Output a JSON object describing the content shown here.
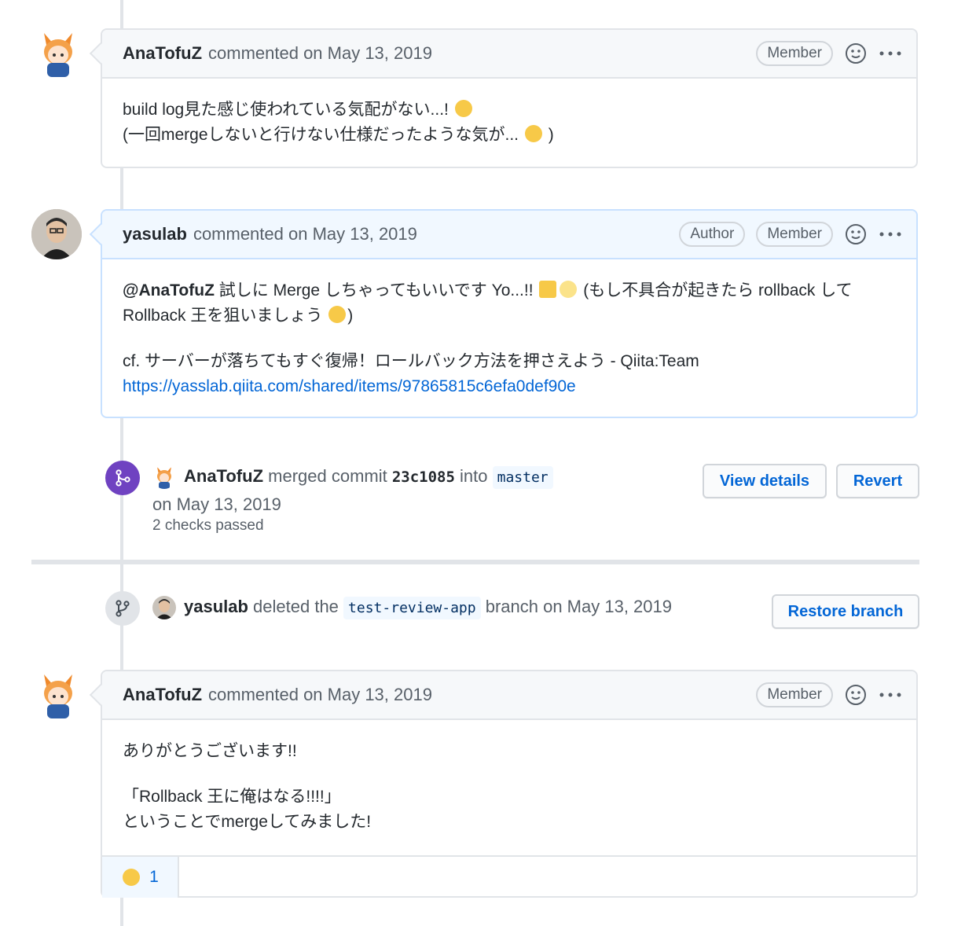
{
  "comments": [
    {
      "author": "AnaTofuZ",
      "meta": "commented on May 13, 2019",
      "badges": [
        "Member"
      ],
      "lines": [
        "build log見た感じ使われている気配がない...! ",
        "(一回mergeしないと行けない仕様だったような気が... ",
        " )"
      ]
    },
    {
      "author": "yasulab",
      "meta": "commented on May 13, 2019",
      "badges": [
        "Author",
        "Member"
      ],
      "mention": "@AnaTofuZ",
      "text1": " 試しに Merge しちゃってもいいです Yo...!! ",
      "text2": " (もし不具合が起きたら rollback して",
      "text3": "Rollback 王を狙いましょう ",
      "text4": ")",
      "cf_text": "cf. サーバーが落ちてもすぐ復帰！ロールバック方法を押さえよう - Qiita:Team",
      "link": "https://yasslab.qiita.com/shared/items/97865815c6efa0def90e"
    },
    {
      "author": "AnaTofuZ",
      "meta": "commented on May 13, 2019",
      "badges": [
        "Member"
      ],
      "lines": [
        "ありがとうございます!!",
        "「Rollback 王に俺はなる!!!!」",
        "ということでmergeしてみました!"
      ],
      "reaction_count": "1"
    }
  ],
  "merge_event": {
    "actor": "AnaTofuZ",
    "text_merged": " merged commit ",
    "commit": "23c1085",
    "text_into": " into ",
    "branch": "master",
    "date": "on May 13, 2019",
    "checks": "2 checks passed",
    "view_details": "View details",
    "revert": "Revert"
  },
  "delete_event": {
    "actor": "yasulab",
    "text_deleted": " deleted the ",
    "branch": "test-review-app",
    "text_after": " branch on May 13, 2019",
    "restore": "Restore branch"
  },
  "icons": {
    "reaction": "smiley-icon",
    "more": "kebab-icon",
    "merge": "git-merge-icon",
    "branch": "git-branch-icon"
  },
  "colors": {
    "merge_purple": "#6f42c1",
    "link_blue": "#0366d6",
    "author_border": "#c8e1ff"
  }
}
